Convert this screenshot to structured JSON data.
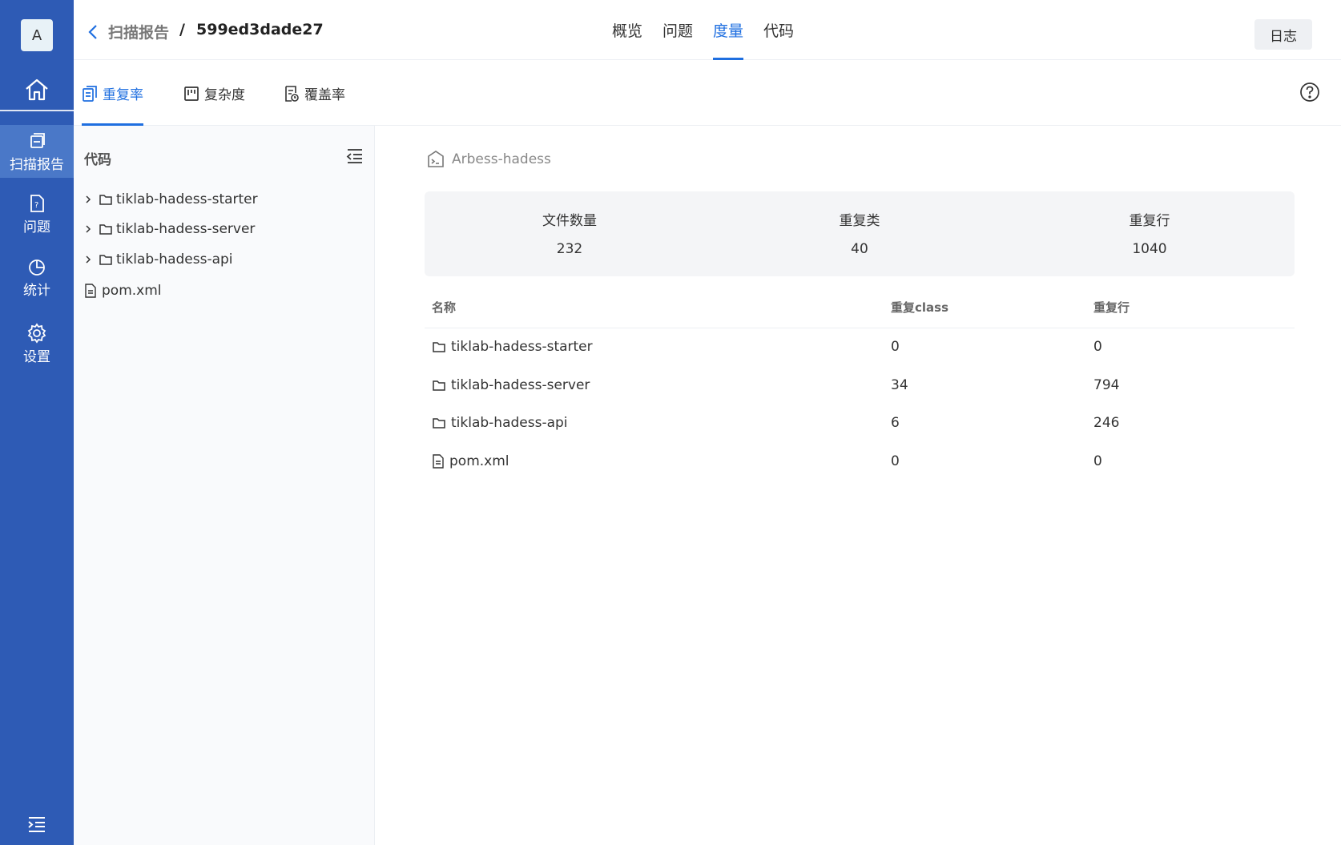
{
  "nav": {
    "avatar_letter": "A",
    "items": [
      {
        "label": "扫描报告",
        "icon": "report-icon",
        "active": true
      },
      {
        "label": "问题",
        "icon": "issue-icon",
        "active": false
      },
      {
        "label": "统计",
        "icon": "chart-pie-icon",
        "active": false
      },
      {
        "label": "设置",
        "icon": "gear-icon",
        "active": false
      }
    ]
  },
  "header": {
    "breadcrumb_parent": "扫描报告",
    "breadcrumb_sep": "/",
    "breadcrumb_current": "599ed3dade27",
    "tabs": [
      "概览",
      "问题",
      "度量",
      "代码"
    ],
    "active_tab": "度量",
    "log_label": "日志"
  },
  "subtabs": [
    {
      "label": "重复率",
      "icon": "duplicate-icon",
      "active": true
    },
    {
      "label": "复杂度",
      "icon": "complexity-icon",
      "active": false
    },
    {
      "label": "覆盖率",
      "icon": "coverage-icon",
      "active": false
    }
  ],
  "tree": {
    "title": "代码",
    "items": [
      {
        "name": "tiklab-hadess-starter",
        "type": "folder"
      },
      {
        "name": "tiklab-hadess-server",
        "type": "folder"
      },
      {
        "name": "tiklab-hadess-api",
        "type": "folder"
      },
      {
        "name": "pom.xml",
        "type": "file"
      }
    ]
  },
  "main": {
    "project_name": "Arbess-hadess",
    "stats": [
      {
        "label": "文件数量",
        "value": "232"
      },
      {
        "label": "重复类",
        "value": "40"
      },
      {
        "label": "重复行",
        "value": "1040"
      }
    ],
    "table": {
      "headers": [
        "名称",
        "重复class",
        "重复行"
      ],
      "rows": [
        {
          "name": "tiklab-hadess-starter",
          "type": "folder",
          "dup_class": "0",
          "dup_lines": "0"
        },
        {
          "name": "tiklab-hadess-server",
          "type": "folder",
          "dup_class": "34",
          "dup_lines": "794"
        },
        {
          "name": "tiklab-hadess-api",
          "type": "folder",
          "dup_class": "6",
          "dup_lines": "246"
        },
        {
          "name": "pom.xml",
          "type": "file",
          "dup_class": "0",
          "dup_lines": "0"
        }
      ]
    }
  },
  "colors": {
    "sidebar": "#2e5bb5",
    "accent": "#1f6fe0"
  }
}
